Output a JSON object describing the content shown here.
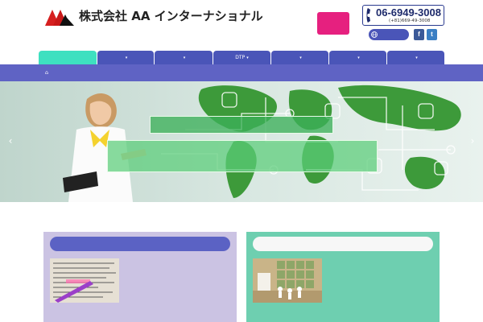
{
  "header": {
    "company_name": "株式会社 AA インターナショナル",
    "tagline": "",
    "inquiry_button": [
      "",
      ""
    ],
    "phone_main": "06-6949-3008",
    "phone_intl": "(+81)669-49-3008",
    "language_button": "",
    "facebook_label": "f",
    "twitter_label": "t"
  },
  "nav": {
    "tabs": [
      {
        "label": "",
        "active": true,
        "has_dropdown": false
      },
      {
        "label": "",
        "active": false,
        "has_dropdown": true
      },
      {
        "label": "",
        "active": false,
        "has_dropdown": true
      },
      {
        "label": "DTP",
        "active": false,
        "has_dropdown": true
      },
      {
        "label": "",
        "active": false,
        "has_dropdown": true
      },
      {
        "label": "",
        "active": false,
        "has_dropdown": true
      },
      {
        "label": "",
        "active": false,
        "has_dropdown": true
      }
    ]
  },
  "breadcrumb": {
    "home_icon": "home-icon",
    "text": ""
  },
  "hero": {
    "caption_small": "",
    "caption_large": "",
    "prev_icon": "chevron-left-icon",
    "next_icon": "chevron-right-icon"
  },
  "panels": {
    "left": {
      "title": "",
      "text_before_link": "",
      "link_text": "",
      "text_after_link": ""
    },
    "right": {
      "title": "",
      "text": ""
    }
  },
  "colors": {
    "brand_navy": "#1d2a6b",
    "nav_purple": "#4a55b8",
    "nav_active_teal": "#3ee0c0",
    "breadcrumb_bar": "#5f63c4",
    "inquiry_pink": "#e6207f",
    "panel_left_bg": "#cbc3e3",
    "panel_right_bg": "#6ecfb0",
    "link_red": "#d6282a"
  }
}
